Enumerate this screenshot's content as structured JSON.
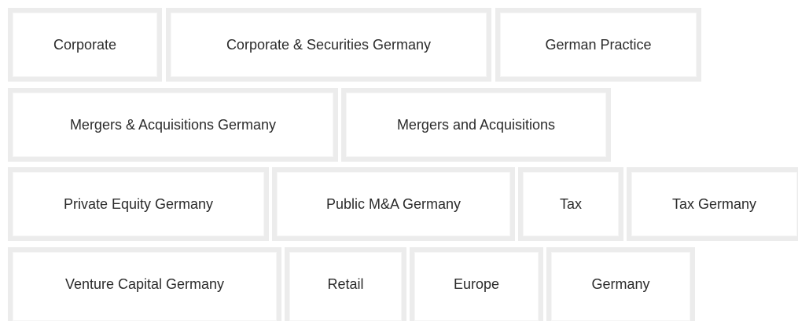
{
  "tags": [
    {
      "label": "Corporate"
    },
    {
      "label": "Corporate & Securities Germany"
    },
    {
      "label": "German Practice"
    },
    {
      "label": "Mergers & Acquisitions Germany"
    },
    {
      "label": "Mergers and Acquisitions"
    },
    {
      "label": "Private Equity Germany"
    },
    {
      "label": "Public M&A Germany"
    },
    {
      "label": "Tax"
    },
    {
      "label": "Tax Germany"
    },
    {
      "label": "Venture Capital Germany"
    },
    {
      "label": "Retail"
    },
    {
      "label": "Europe"
    },
    {
      "label": "Germany"
    }
  ]
}
